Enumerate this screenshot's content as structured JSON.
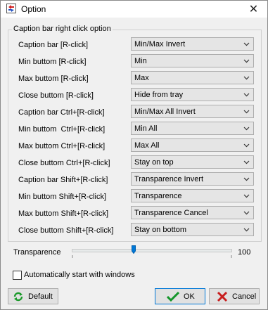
{
  "window": {
    "title": "Option"
  },
  "group": {
    "title": "Caption bar right click option"
  },
  "rows": [
    {
      "label": "Caption bar [R-click]",
      "value": "Min/Max Invert"
    },
    {
      "label": "Min buttom [R-click]",
      "value": "Min"
    },
    {
      "label": "Max buttom [R-click]",
      "value": "Max"
    },
    {
      "label": "Close buttom [R-click]",
      "value": "Hide from tray"
    },
    {
      "label": "Caption bar Ctrl+[R-click]",
      "value": "Min/Max All Invert"
    },
    {
      "label": "Min buttom  Ctrl+[R-click]",
      "value": "Min All"
    },
    {
      "label": "Max buttom Ctrl+[R-click]",
      "value": "Max All"
    },
    {
      "label": "Close buttom Ctrl+[R-click]",
      "value": "Stay on top"
    },
    {
      "label": "Caption bar Shift+[R-click]",
      "value": "Transparence Invert"
    },
    {
      "label": "Min buttom Shift+[R-click]",
      "value": "Transparence"
    },
    {
      "label": "Max buttom Shift+[R-click]",
      "value": "Transparence Cancel"
    },
    {
      "label": "Close buttom Shift+[R-click]",
      "value": "Stay on bottom"
    }
  ],
  "transparence": {
    "label": "Transparence",
    "value": "100"
  },
  "autostart": {
    "label": "Automatically start with windows",
    "checked": false
  },
  "buttons": {
    "default": "Default",
    "ok": "OK",
    "cancel": "Cancel"
  }
}
